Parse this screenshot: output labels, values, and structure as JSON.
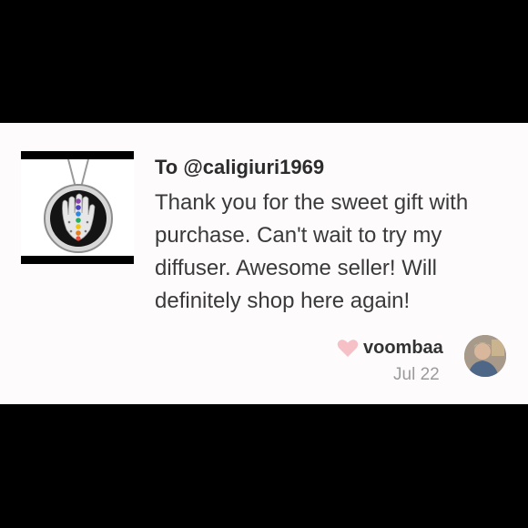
{
  "review": {
    "recipient": "To @caligiuri1969",
    "message": "Thank you for the sweet gift with purchase. Can't wait to try my diffuser. Awesome seller! Will definitely shop here again!",
    "username": "voombaa",
    "date": "Jul 22"
  },
  "product_image": {
    "subject": "hamsa-chakra-diffuser-locket"
  },
  "icons": {
    "like": "heart-icon"
  },
  "colors": {
    "background": "#000000",
    "card": "#fdfbfb",
    "heart": "#f6c1c6",
    "date": "#9b9b9b"
  }
}
